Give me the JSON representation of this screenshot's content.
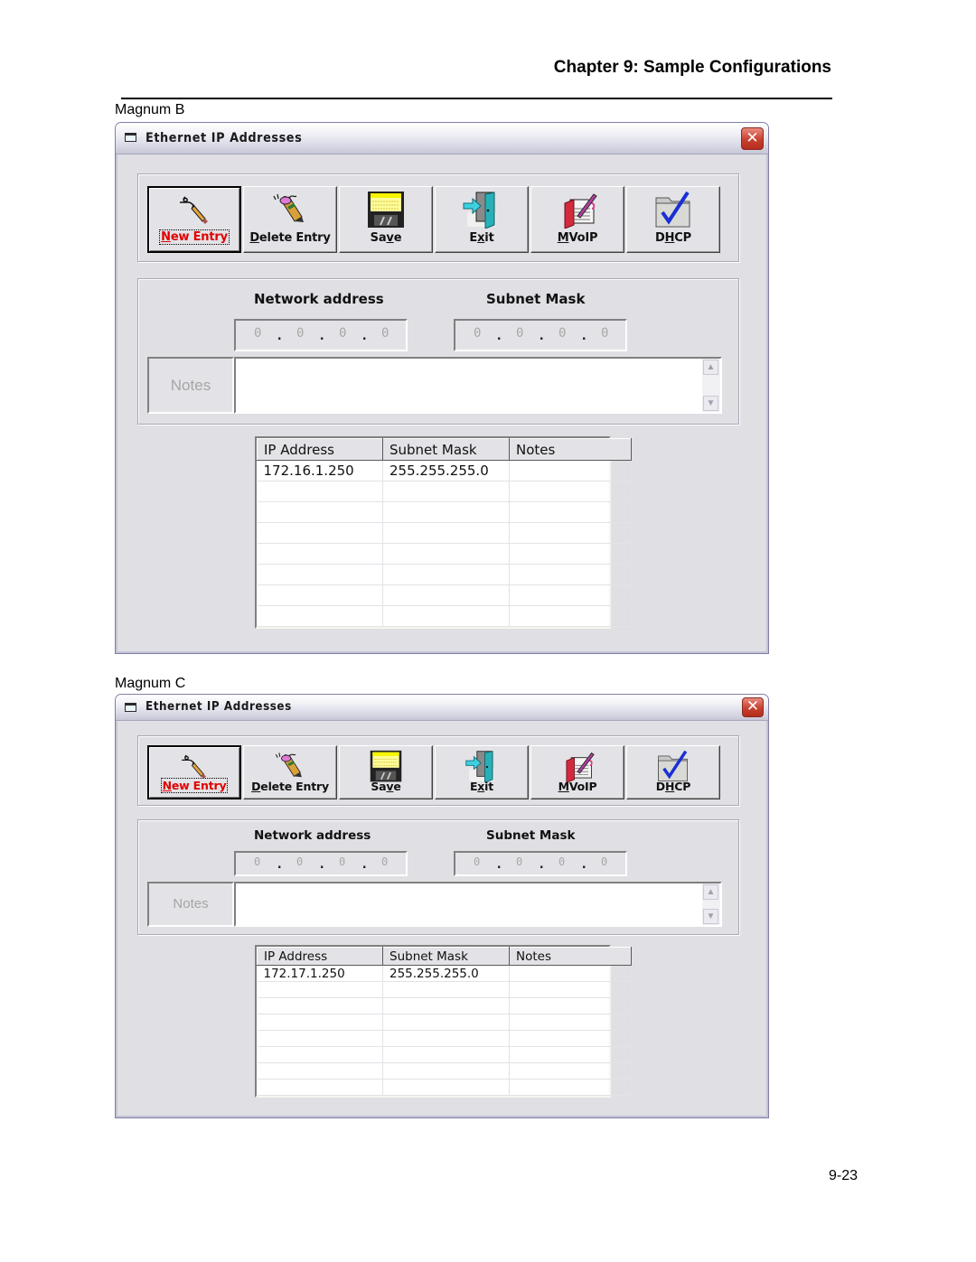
{
  "page": {
    "chapter_title": "Chapter 9: Sample Configurations",
    "page_number": "9-23"
  },
  "windows": [
    {
      "caption": "Magnum B",
      "title": "Ethernet IP Addresses",
      "close_icon": "close-icon",
      "toolbar": [
        {
          "label": "New Entry",
          "icon": "pencil-write-icon",
          "active": true
        },
        {
          "label": "Delete Entry",
          "icon": "pencil-eraser-icon",
          "active": false
        },
        {
          "label": "Save",
          "icon": "floppy-disk-icon",
          "active": false
        },
        {
          "label": "Exit",
          "icon": "exit-door-icon",
          "active": false
        },
        {
          "label": "MVoIP",
          "icon": "notebook-pen-icon",
          "active": false
        },
        {
          "label": "DHCP",
          "icon": "folder-check-icon",
          "active": false
        }
      ],
      "network_address_label": "Network address",
      "subnet_mask_label": "Subnet Mask",
      "network_address_value": [
        "0",
        "0",
        "0",
        "0"
      ],
      "subnet_mask_value": [
        "0",
        "0",
        "0",
        "0"
      ],
      "notes_label": "Notes",
      "notes_value": "",
      "table": {
        "columns": [
          "IP Address",
          "Subnet Mask",
          "Notes"
        ],
        "rows": [
          [
            "172.16.1.250",
            "255.255.255.0",
            ""
          ],
          [
            "",
            "",
            ""
          ],
          [
            "",
            "",
            ""
          ],
          [
            "",
            "",
            ""
          ],
          [
            "",
            "",
            ""
          ],
          [
            "",
            "",
            ""
          ],
          [
            "",
            "",
            ""
          ],
          [
            "",
            "",
            ""
          ]
        ]
      }
    },
    {
      "caption": "Magnum C",
      "title": "Ethernet IP Addresses",
      "close_icon": "close-icon",
      "toolbar": [
        {
          "label": "New Entry",
          "icon": "pencil-write-icon",
          "active": true
        },
        {
          "label": "Delete Entry",
          "icon": "pencil-eraser-icon",
          "active": false
        },
        {
          "label": "Save",
          "icon": "floppy-disk-icon",
          "active": false
        },
        {
          "label": "Exit",
          "icon": "exit-door-icon",
          "active": false
        },
        {
          "label": "MVoIP",
          "icon": "notebook-pen-icon",
          "active": false
        },
        {
          "label": "DHCP",
          "icon": "folder-check-icon",
          "active": false
        }
      ],
      "network_address_label": "Network address",
      "subnet_mask_label": "Subnet Mask",
      "network_address_value": [
        "0",
        "0",
        "0",
        "0"
      ],
      "subnet_mask_value": [
        "0",
        "0",
        "0",
        "0"
      ],
      "notes_label": "Notes",
      "notes_value": "",
      "table": {
        "columns": [
          "IP Address",
          "Subnet Mask",
          "Notes"
        ],
        "rows": [
          [
            "172.17.1.250",
            "255.255.255.0",
            ""
          ],
          [
            "",
            "",
            ""
          ],
          [
            "",
            "",
            ""
          ],
          [
            "",
            "",
            ""
          ],
          [
            "",
            "",
            ""
          ],
          [
            "",
            "",
            ""
          ],
          [
            "",
            "",
            ""
          ],
          [
            "",
            "",
            ""
          ]
        ]
      }
    }
  ]
}
